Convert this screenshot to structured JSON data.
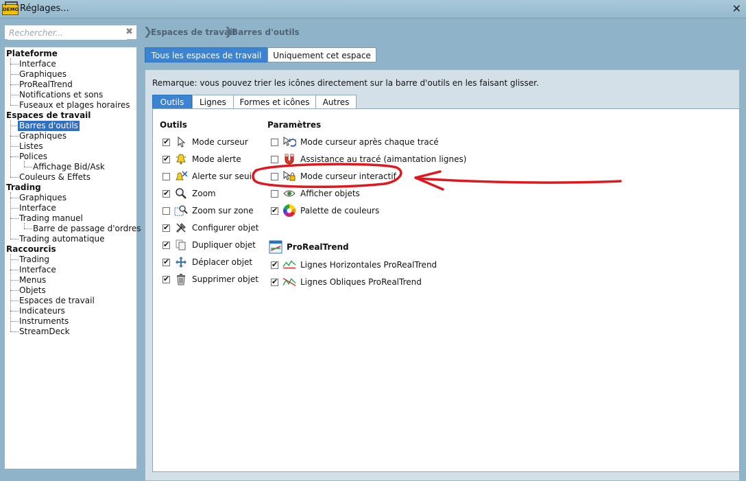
{
  "window": {
    "title": "Réglages...",
    "logo_text": "DEMO"
  },
  "search": {
    "placeholder": "Rechercher..."
  },
  "tree": {
    "platform": "Plateforme",
    "platform_items": [
      "Interface",
      "Graphiques",
      "ProRealTrend",
      "Notifications et sons",
      "Fuseaux et plages horaires"
    ],
    "workspaces": "Espaces de travail",
    "ws_items": [
      "Barres d'outils",
      "Graphiques",
      "Listes",
      "Polices",
      "Affichage Bid/Ask",
      "Couleurs & Effets"
    ],
    "trading": "Trading",
    "tr_items": [
      "Graphiques",
      "Interface",
      "Trading manuel",
      "Barre de passage d'ordres",
      "Trading automatique"
    ],
    "shortcuts": "Raccourcis",
    "sc_items": [
      "Trading",
      "Interface",
      "Menus",
      "Objets",
      "Espaces de travail",
      "Indicateurs",
      "Instruments",
      "StreamDeck"
    ]
  },
  "breadcrumb": [
    "Espaces de travail",
    "Barres d'outils"
  ],
  "scope": {
    "all": "Tous les espaces de travail",
    "this": "Uniquement cet espace"
  },
  "remark": "Remarque: vous pouvez trier les icônes directement sur la barre d'outils en les faisant glisser.",
  "tabs": [
    "Outils",
    "Lignes",
    "Formes et icônes",
    "Autres"
  ],
  "tools": {
    "heading": "Outils",
    "items": [
      {
        "label": "Mode curseur",
        "checked": true,
        "icon": "cursor-icon"
      },
      {
        "label": "Mode alerte",
        "checked": true,
        "icon": "bell-icon"
      },
      {
        "label": "Alerte sur seuil",
        "checked": false,
        "icon": "bell-threshold-icon"
      },
      {
        "label": "Zoom",
        "checked": true,
        "icon": "magnifier-icon"
      },
      {
        "label": "Zoom sur zone",
        "checked": false,
        "icon": "zoom-area-icon"
      },
      {
        "label": "Configurer objet",
        "checked": true,
        "icon": "tools-icon"
      },
      {
        "label": "Dupliquer objet",
        "checked": true,
        "icon": "duplicate-icon"
      },
      {
        "label": "Déplacer objet",
        "checked": true,
        "icon": "move-arrows-icon"
      },
      {
        "label": "Supprimer objet",
        "checked": true,
        "icon": "trash-icon"
      }
    ]
  },
  "params": {
    "heading": "Paramètres",
    "items": [
      {
        "label": "Mode curseur après chaque tracé",
        "checked": false,
        "icon": "cursor-reset-icon"
      },
      {
        "label": "Assistance au tracé (aimantation lignes)",
        "checked": false,
        "icon": "magnet-icon"
      },
      {
        "label": "Mode curseur interactif",
        "checked": false,
        "icon": "interactive-cursor-icon"
      },
      {
        "label": "Afficher objets",
        "checked": false,
        "icon": "eye-icon"
      },
      {
        "label": "Palette de couleurs",
        "checked": true,
        "icon": "color-palette-icon"
      }
    ]
  },
  "prorealtrend": {
    "heading": "ProRealTrend",
    "items": [
      {
        "label": "Lignes Horizontales ProRealTrend",
        "checked": true,
        "icon": "horizontal-lines-icon"
      },
      {
        "label": "Lignes Obliques ProRealTrend",
        "checked": true,
        "icon": "oblique-lines-icon"
      }
    ]
  },
  "colors": {
    "accent": "#3b83d3",
    "selected": "#2f6fc5",
    "annotation": "#e0171f"
  }
}
